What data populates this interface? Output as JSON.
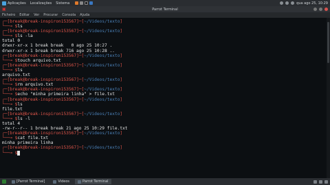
{
  "system_panel": {
    "menus": [
      "Aplicações",
      "Localizações",
      "Sistema"
    ],
    "clock": "qua ago 25, 10:29"
  },
  "window": {
    "title": "Parrot Terminal",
    "menu": [
      "Ficheiro",
      "Editar",
      "Ver",
      "Procurar",
      "Consola",
      "Ajuda"
    ]
  },
  "terminal": {
    "user": "break",
    "host": "break-inspiron153567",
    "path": "~/Videos/texto",
    "entries": [
      {
        "cmd": "ls",
        "output": []
      },
      {
        "cmd": "ls -la",
        "output": [
          "total 0",
          "drwxr-xr-x 1 break break   0 ago 25 10:27 .",
          "drwxr-xr-x 1 break break 716 ago 25 10:28 .."
        ]
      },
      {
        "cmd": "touch arquivo.txt",
        "output": []
      },
      {
        "cmd": "ls",
        "output": [
          "arquivo.txt"
        ]
      },
      {
        "cmd": "rm arquivo.txt",
        "output": []
      },
      {
        "cmd": "echo \"minha primeira linha\" > file.txt",
        "output": []
      },
      {
        "cmd": "ls",
        "output": [
          "file.txt"
        ]
      },
      {
        "cmd": "ls -l",
        "output": [
          "total 4",
          "-rw-r--r-- 1 break break 21 ago 25 10:29 file.txt"
        ]
      },
      {
        "cmd": "cat file.txt",
        "output": [
          "minha primeira linha"
        ]
      },
      {
        "cmd": "",
        "output": []
      }
    ]
  },
  "taskbar": {
    "tasks": [
      {
        "label": "[Parrot Terminal]",
        "active": false
      },
      {
        "label": "Videos",
        "active": false
      },
      {
        "label": "Parrot Terminal",
        "active": true
      }
    ]
  }
}
